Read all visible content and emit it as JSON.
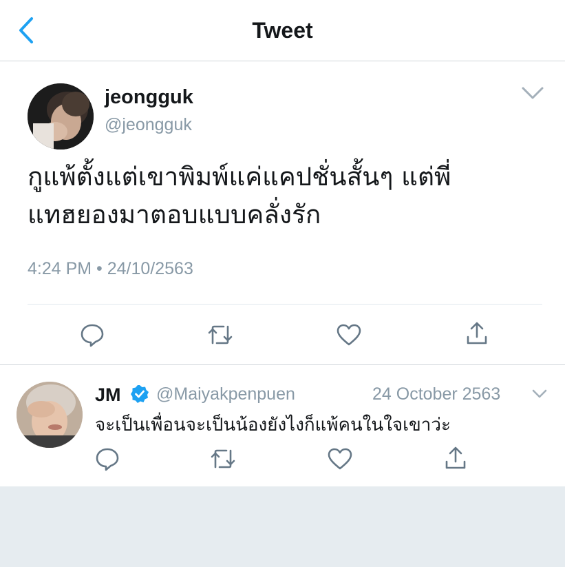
{
  "header": {
    "title": "Tweet",
    "back_icon": "chevron-left-icon",
    "accent_color": "#1da1f2"
  },
  "main_tweet": {
    "display_name": "jeongguk",
    "handle": "@jeongguk",
    "text_lines": [
      "กูแพ้ตั้งแต่เขาพิมพ์แค่แคปชั่นสั้นๆ แต่พี่",
      "แทฮยองมาตอบแบบคลั่งรัก"
    ],
    "timestamp": "4:24 PM • 24/10/2563",
    "actions": [
      "reply-icon",
      "retweet-icon",
      "like-icon",
      "share-icon"
    ]
  },
  "reply_tweet": {
    "display_name": "JM",
    "verified": true,
    "handle": "@Maiyakpenpuen",
    "date": "24 October 2563",
    "text": "จะเป็นเพื่อนจะเป็นน้องยังไงก็แพ้คนในใจเขาว่ะ",
    "actions": [
      "reply-icon",
      "retweet-icon",
      "like-icon",
      "share-icon"
    ]
  },
  "colors": {
    "text_primary": "#14171a",
    "text_secondary": "#8899a6",
    "icon_gray": "#657786",
    "divider": "#cfd5da",
    "footer_background": "#e6ecf0",
    "verified_blue": "#1da1f2"
  }
}
